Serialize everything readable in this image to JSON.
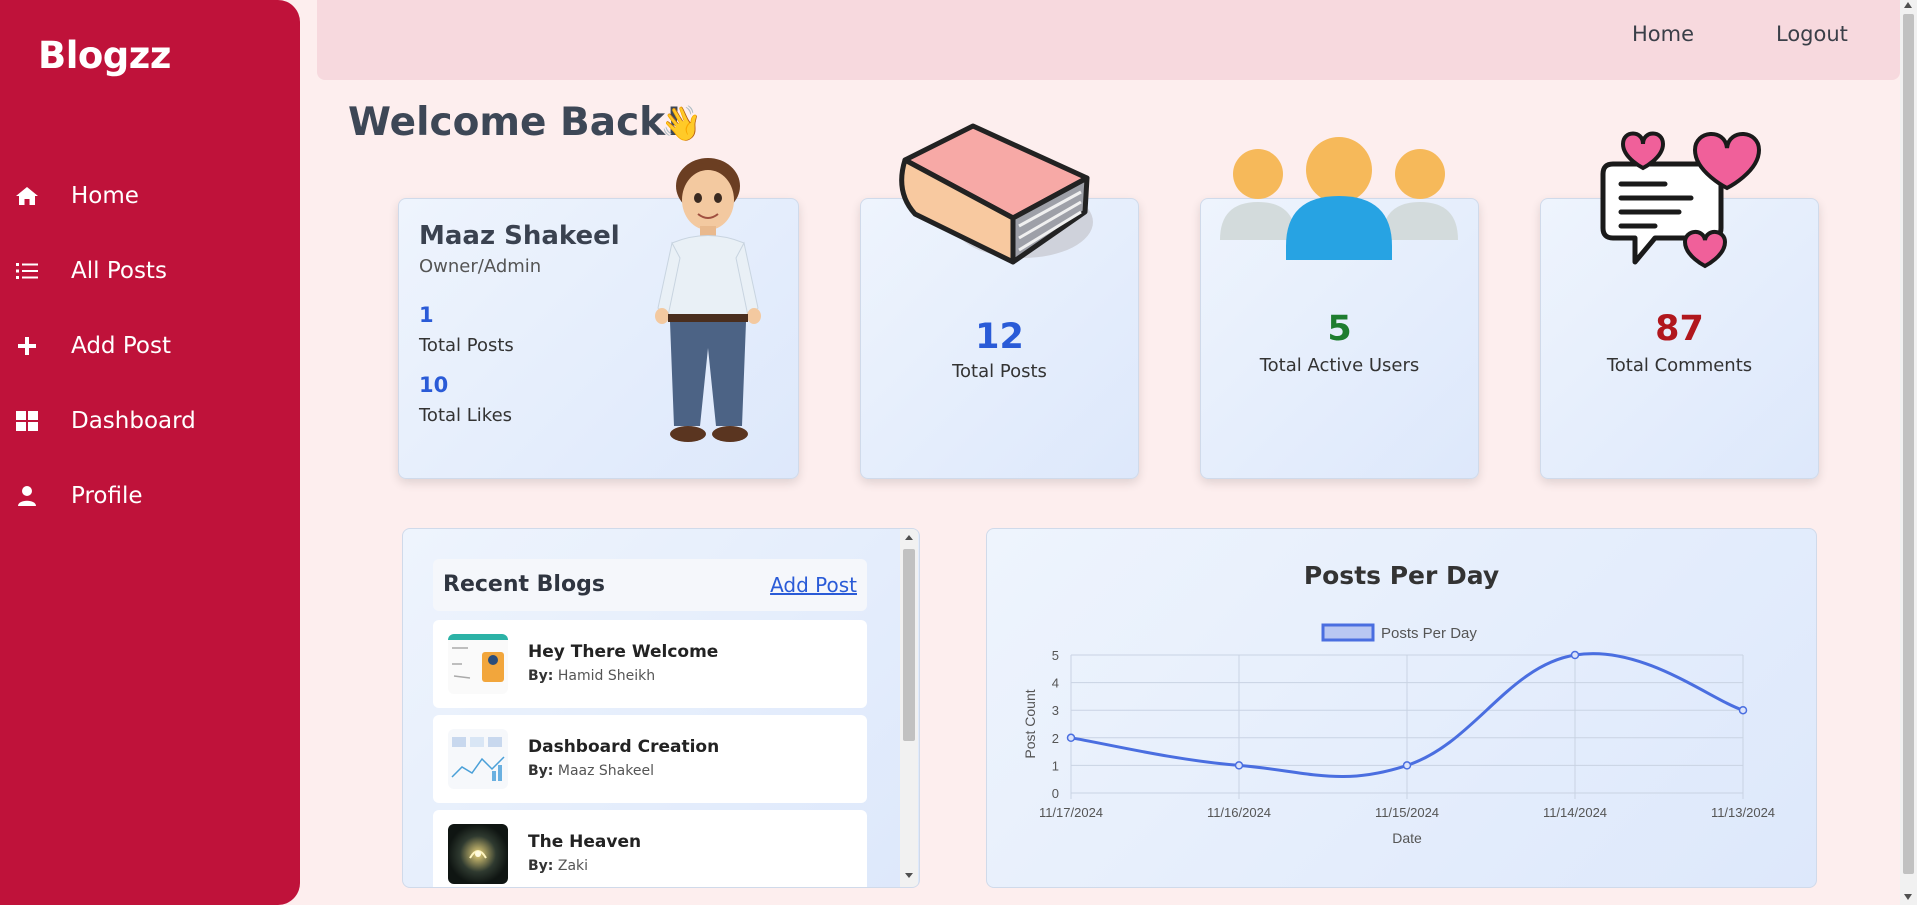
{
  "sidebar": {
    "brand": "Blogzz",
    "items": [
      {
        "label": "Home",
        "icon": "home-icon"
      },
      {
        "label": "All Posts",
        "icon": "list-icon"
      },
      {
        "label": "Add Post",
        "icon": "plus-icon"
      },
      {
        "label": "Dashboard",
        "icon": "grid-icon"
      },
      {
        "label": "Profile",
        "icon": "user-icon"
      }
    ]
  },
  "topbar": {
    "home": "Home",
    "logout": "Logout"
  },
  "welcome": {
    "title": "Welcome Back!",
    "emoji": "👋"
  },
  "profile": {
    "name": "Maaz Shakeel",
    "role": "Owner/Admin",
    "posts_value": "1",
    "posts_label": "Total Posts",
    "likes_value": "10",
    "likes_label": "Total Likes"
  },
  "stats": [
    {
      "value": "12",
      "label": "Total Posts",
      "color": "#2a5bd7",
      "icon": "book-icon"
    },
    {
      "value": "5",
      "label": "Total Active Users",
      "color": "#1e7d2f",
      "icon": "users-icon"
    },
    {
      "value": "87",
      "label": "Total Comments",
      "color": "#b1171d",
      "icon": "comments-heart-icon"
    }
  ],
  "recent_blogs": {
    "title": "Recent Blogs",
    "add_link": "Add Post",
    "by_label": "By:",
    "items": [
      {
        "title": "Hey There Welcome",
        "author": "Hamid Sheikh"
      },
      {
        "title": "Dashboard Creation",
        "author": "Maaz Shakeel"
      },
      {
        "title": "The Heaven",
        "author": "Zaki"
      }
    ]
  },
  "chart_data": {
    "type": "line",
    "title": "Posts Per Day",
    "series": [
      {
        "name": "Posts Per Day",
        "values": [
          2,
          1,
          1,
          5,
          3
        ],
        "color": "#4a6ee0"
      }
    ],
    "categories": [
      "11/17/2024",
      "11/16/2024",
      "11/15/2024",
      "11/14/2024",
      "11/13/2024"
    ],
    "xlabel": "Date",
    "ylabel": "Post Count",
    "ylim": [
      0,
      5
    ],
    "yticks": [
      "0",
      "1",
      "2",
      "3",
      "4",
      "5"
    ],
    "grid": true,
    "legend": "top-center"
  }
}
